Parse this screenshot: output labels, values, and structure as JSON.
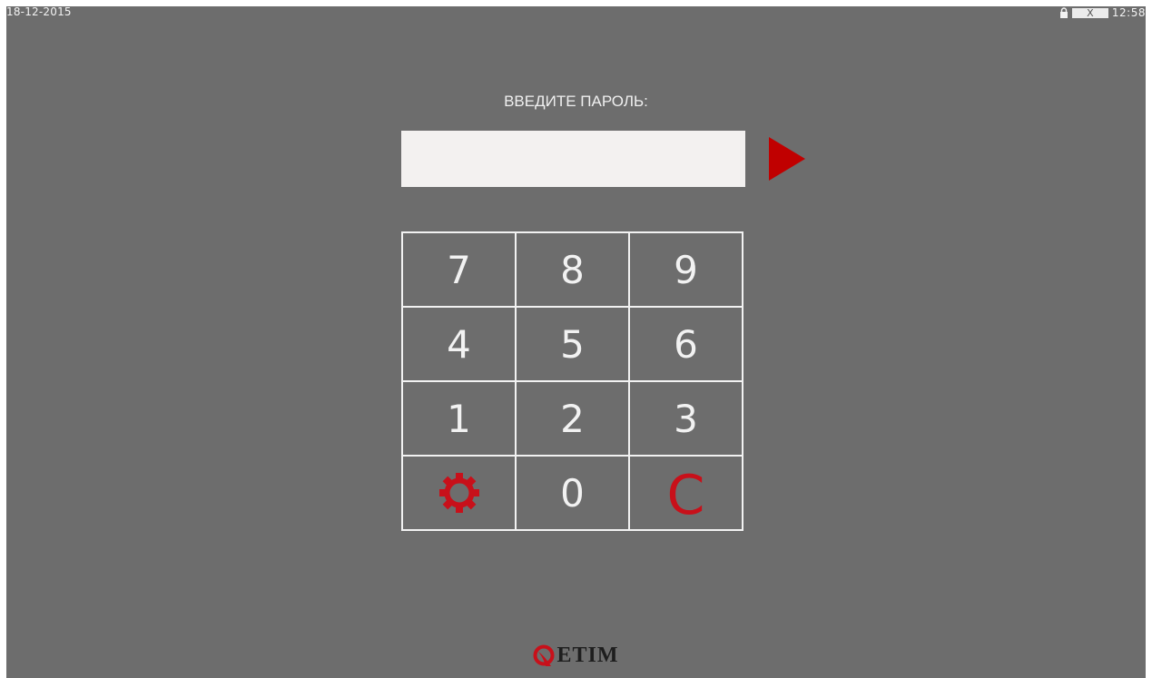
{
  "status_bar": {
    "date": "18-12-2015",
    "close_label": "X",
    "time": "12:58"
  },
  "login": {
    "prompt": "ВВЕДИТЕ ПАРОЛЬ:",
    "password_value": ""
  },
  "keypad": {
    "k7": "7",
    "k8": "8",
    "k9": "9",
    "k4": "4",
    "k5": "5",
    "k6": "6",
    "k1": "1",
    "k2": "2",
    "k3": "3",
    "settings_icon": "gear-icon",
    "k0": "0",
    "clear": "C"
  },
  "logo": {
    "text": "ETIM"
  },
  "colors": {
    "background": "#6d6d6d",
    "accent": "#c8101a",
    "input_bg": "#f3f1f0",
    "text": "#f2f2f2"
  }
}
